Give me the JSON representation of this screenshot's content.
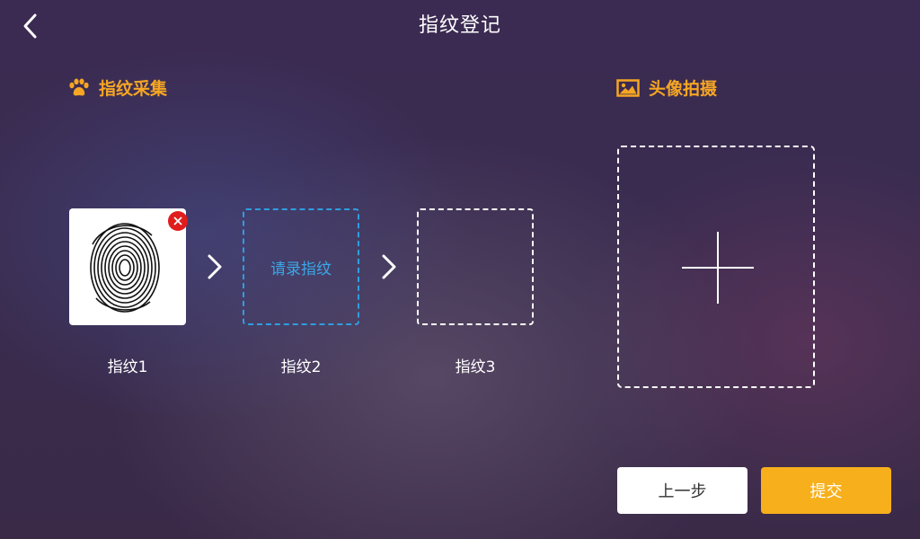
{
  "header": {
    "title": "指纹登记",
    "back_icon": "chevron-left-icon"
  },
  "fingerprint_section": {
    "title": "指纹采集",
    "icon": "paw-icon",
    "icon_color": "#f6a623",
    "slots": [
      {
        "label": "指纹1",
        "state": "captured"
      },
      {
        "label": "指纹2",
        "state": "active",
        "prompt": "请录指纹"
      },
      {
        "label": "指纹3",
        "state": "empty"
      }
    ]
  },
  "avatar_section": {
    "title": "头像拍摄",
    "icon": "image-icon",
    "add_icon": "plus-icon"
  },
  "actions": {
    "prev_label": "上一步",
    "submit_label": "提交",
    "submit_color": "#f7b01c"
  }
}
